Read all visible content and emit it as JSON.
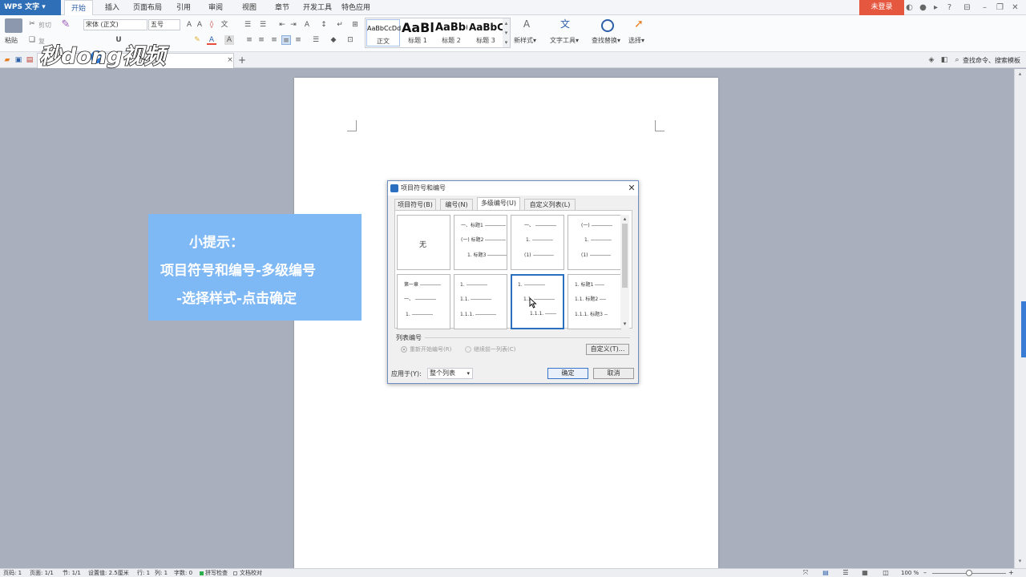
{
  "app": {
    "name": "WPS 文字",
    "login_label": "未登录"
  },
  "menu_tabs": [
    "开始",
    "插入",
    "页面布局",
    "引用",
    "审阅",
    "视图",
    "章节",
    "开发工具",
    "特色应用"
  ],
  "ribbon": {
    "paste_label": "粘贴",
    "cut_label": "剪切",
    "copy_label": "复",
    "font_name": "宋体 (正文)",
    "font_size": "五号",
    "styles": [
      {
        "sample": "AaBbCcDd",
        "name": "正文"
      },
      {
        "sample": "AaBl",
        "name": "标题 1"
      },
      {
        "sample": "AaBb(",
        "name": "标题 2"
      },
      {
        "sample": "AaBbC",
        "name": "标题 3"
      }
    ],
    "new_style_label": "新样式",
    "text_tools_label": "文字工具",
    "find_replace_label": "查找替换",
    "select_label": "选择"
  },
  "search_hint": "查找命令、搜索模板",
  "tip": {
    "heading": "小提示：",
    "line1": "项目符号和编号-多级编号",
    "line2": "-选择样式-点击确定"
  },
  "logo": {
    "text": "秒dong视频"
  },
  "dialog": {
    "title": "项目符号和编号",
    "tabs": [
      "项目符号(B)",
      "编号(N)",
      "多级编号(U)",
      "自定义列表(L)"
    ],
    "active_tab": "多级编号(U)",
    "none_label": "无",
    "options": {
      "o2": [
        "一、标题1",
        "(一) 标题2",
        "1. 标题3"
      ],
      "o3": [
        "一、",
        "1.",
        "(1)"
      ],
      "o4": [
        "(一)",
        "1.",
        "(1)"
      ],
      "o5": [
        "第一章",
        "一、",
        "1."
      ],
      "o6": [
        "1.",
        "1.1.",
        "1.1.1."
      ],
      "o7": [
        "1.",
        "1.1.",
        "1.1.1."
      ],
      "o8": [
        "1. 标题1",
        "1.1. 标题2",
        "1.1.1. 标题3"
      ]
    },
    "list_numbering_label": "列表编号",
    "restart_label": "重新开始编号(R)",
    "continue_label": "继续前一列表(C)",
    "customize_label": "自定义(T)...",
    "apply_to_label": "应用于(Y):",
    "apply_to_value": "整个列表",
    "ok_label": "确定",
    "cancel_label": "取消"
  },
  "status": {
    "page": "页码: 1",
    "pages": "页面: 1/1",
    "section": "节: 1/1",
    "setting": "设置值: 2.5厘米",
    "row": "行: 1",
    "col": "列: 1",
    "words": "字数: 0",
    "spell": "拼写检查",
    "proof": "文档校对",
    "zoom": "100 %"
  }
}
